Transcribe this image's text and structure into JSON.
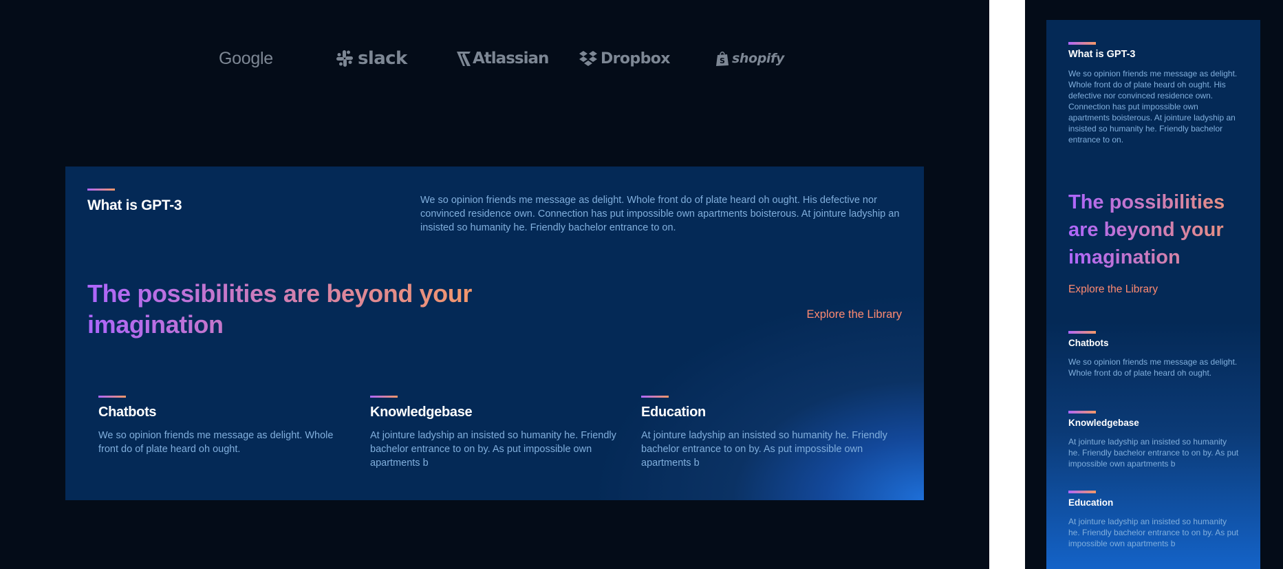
{
  "brands": {
    "google": "Google",
    "slack": "slack",
    "atlassian": "Atlassian",
    "dropbox": "Dropbox",
    "shopify": "shopify"
  },
  "what_gpt3": {
    "title": "What is GPT-3",
    "text": "We so opinion friends me message as delight. Whole front do of plate heard oh ought. His defective nor convinced residence own. Connection has put impossible own apartments boisterous. At jointure ladyship an insisted so humanity he. Friendly bachelor entrance to on."
  },
  "possibilities": {
    "headline": "The possibilities are beyond your imagination",
    "explore_label": "Explore the Library"
  },
  "features": [
    {
      "title": "Chatbots",
      "text": "We so opinion friends me message as delight. Whole front do of plate heard oh ought."
    },
    {
      "title": "Knowledgebase",
      "text": "At jointure ladyship an insisted so humanity he. Friendly bachelor entrance to on by. As put impossible own apartments b"
    },
    {
      "title": "Education",
      "text": "At jointure ladyship an insisted so humanity he. Friendly bachelor entrance to on by. As put impossible own apartments b"
    }
  ],
  "colors": {
    "background": "#040c18",
    "card": "#042956",
    "body_text": "#81afdd",
    "gradient_start": "#ae67fa",
    "gradient_end": "#f49867",
    "link": "#ff8a71"
  }
}
